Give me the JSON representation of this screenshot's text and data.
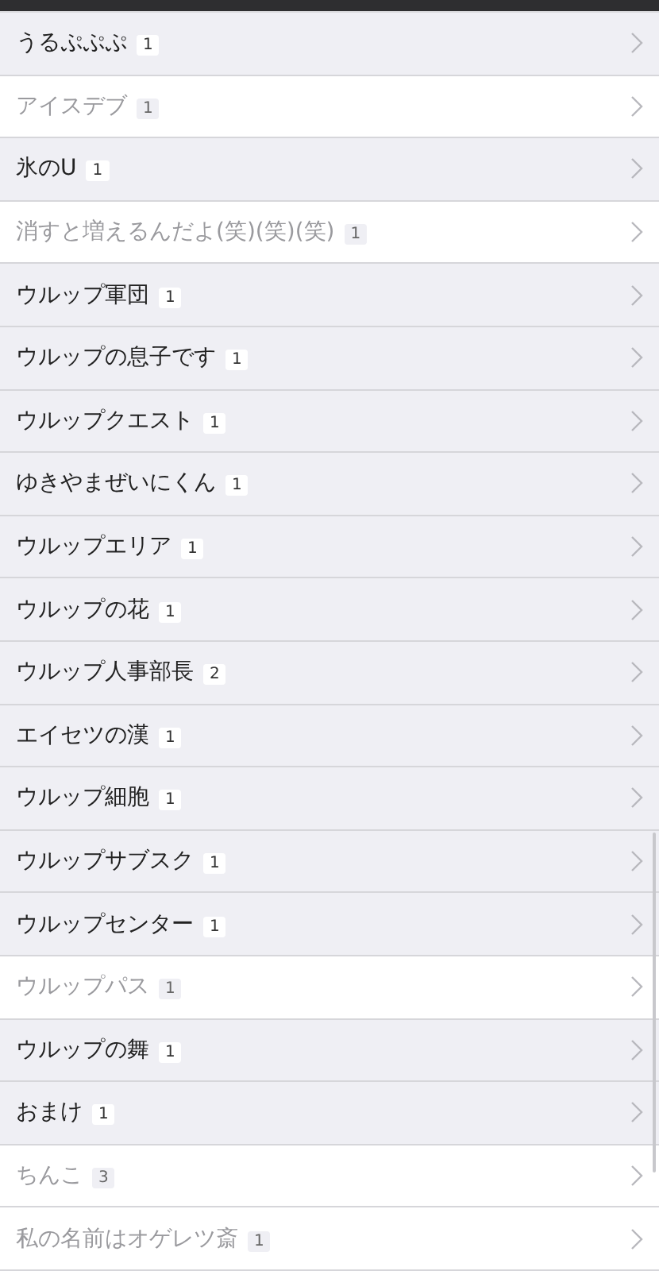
{
  "rows": [
    {
      "title": "うるぷぷぷ",
      "count": "1",
      "visited": false
    },
    {
      "title": "アイスデブ",
      "count": "1",
      "visited": true
    },
    {
      "title": "氷のU",
      "count": "1",
      "visited": false
    },
    {
      "title": "消すと増えるんだよ(笑)(笑)(笑)",
      "count": "1",
      "visited": true
    },
    {
      "title": "ウルップ軍団",
      "count": "1",
      "visited": false
    },
    {
      "title": "ウルップの息子です",
      "count": "1",
      "visited": false
    },
    {
      "title": "ウルップクエスト",
      "count": "1",
      "visited": false
    },
    {
      "title": "ゆきやまぜいにくん",
      "count": "1",
      "visited": false
    },
    {
      "title": "ウルップエリア",
      "count": "1",
      "visited": false
    },
    {
      "title": "ウルップの花",
      "count": "1",
      "visited": false
    },
    {
      "title": "ウルップ人事部長",
      "count": "2",
      "visited": false
    },
    {
      "title": "エイセツの漢",
      "count": "1",
      "visited": false
    },
    {
      "title": "ウルップ細胞",
      "count": "1",
      "visited": false
    },
    {
      "title": "ウルップサブスク",
      "count": "1",
      "visited": false
    },
    {
      "title": "ウルップセンター",
      "count": "1",
      "visited": false
    },
    {
      "title": "ウルップパス",
      "count": "1",
      "visited": true
    },
    {
      "title": "ウルップの舞",
      "count": "1",
      "visited": false
    },
    {
      "title": "おまけ",
      "count": "1",
      "visited": false
    },
    {
      "title": "ちんこ",
      "count": "3",
      "visited": true
    },
    {
      "title": "私の名前はオゲレツ斎",
      "count": "1",
      "visited": true
    }
  ]
}
